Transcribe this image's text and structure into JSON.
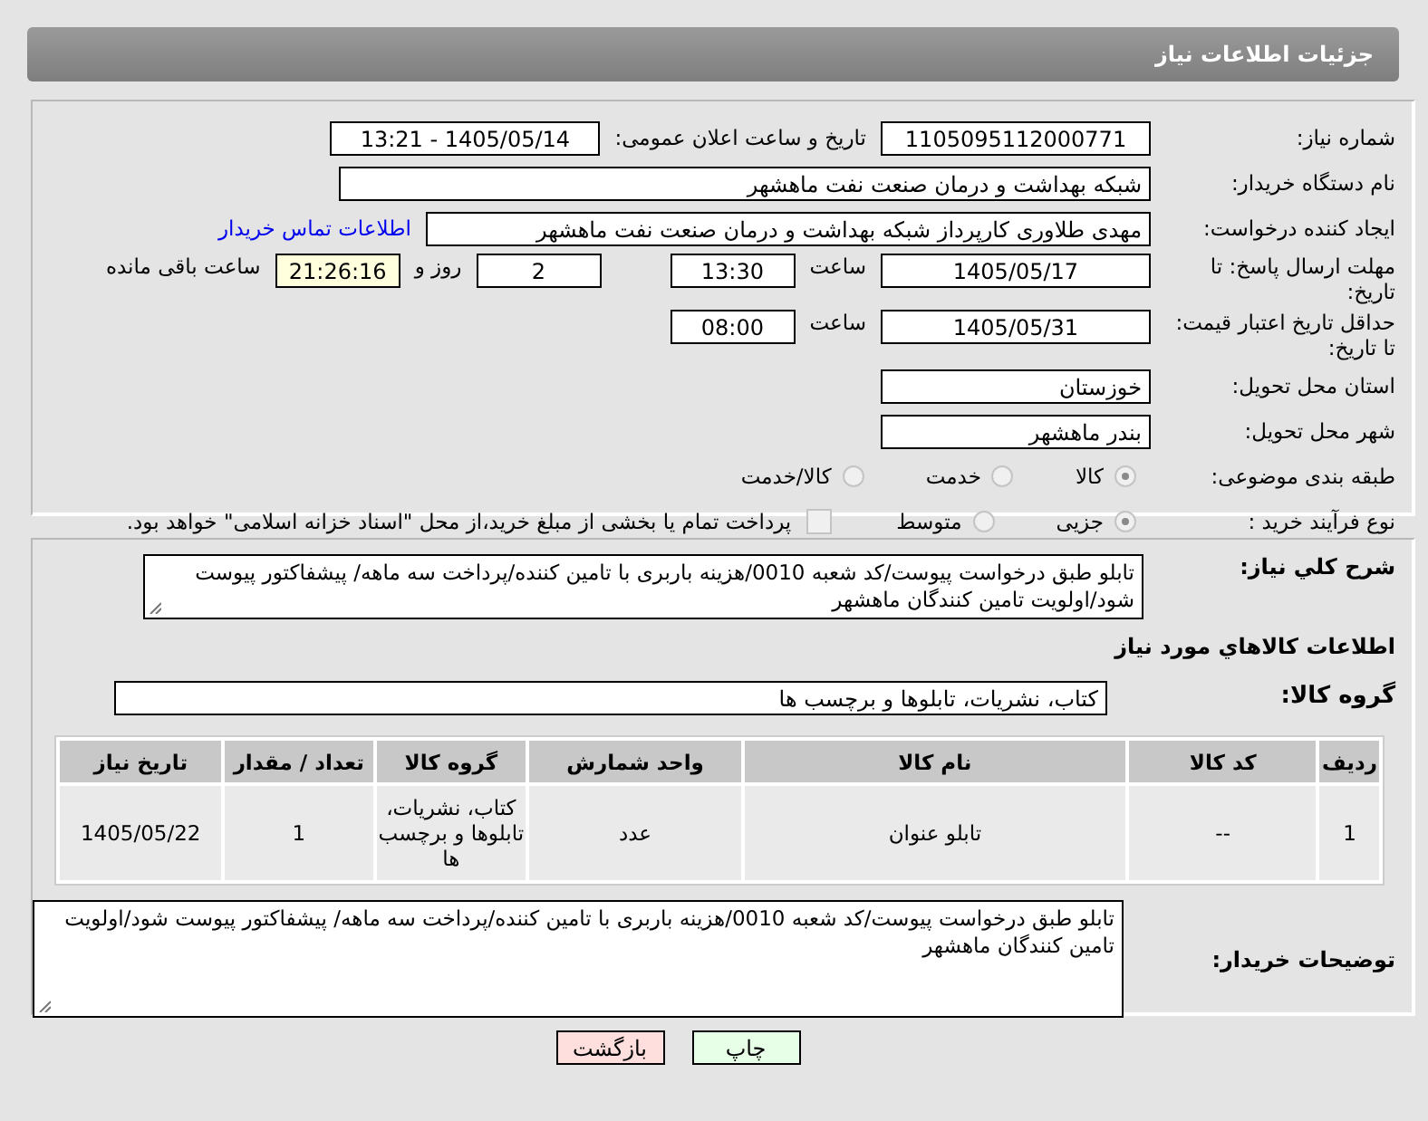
{
  "header": {
    "title": "جزئیات اطلاعات نیاز"
  },
  "need_number": {
    "label": "شماره نیاز:",
    "value": "1105095112000771"
  },
  "announce": {
    "label": "تاریخ و ساعت اعلان عمومی:",
    "value": "1405/05/14 - 13:21"
  },
  "buyer_org": {
    "label": "نام دستگاه خریدار:",
    "value": "شبکه بهداشت و درمان صنعت نفت ماهشهر"
  },
  "requester": {
    "label": "ایجاد کننده درخواست:",
    "value": "مهدی طلاوری کارپرداز شبکه بهداشت و درمان صنعت نفت ماهشهر",
    "link": "اطلاعات تماس خریدار"
  },
  "reply_deadline": {
    "label": "مهلت ارسال پاسخ: تا تاریخ:",
    "date": "1405/05/17",
    "time_label": "ساعت",
    "time": "13:30",
    "days": "2",
    "days_label": "روز و",
    "remaining": "21:26:16",
    "remaining_label": "ساعت باقی مانده"
  },
  "price_validity": {
    "label": "حداقل تاریخ اعتبار قیمت: تا تاریخ:",
    "date": "1405/05/31",
    "time_label": "ساعت",
    "time": "08:00"
  },
  "province": {
    "label": "استان محل تحویل:",
    "value": "خوزستان"
  },
  "city": {
    "label": "شهر محل تحویل:",
    "value": "بندر ماهشهر"
  },
  "category": {
    "label": "طبقه بندی موضوعی:",
    "options": [
      {
        "label": "کالا",
        "selected": true
      },
      {
        "label": "خدمت",
        "selected": false
      },
      {
        "label": "کالا/خدمت",
        "selected": false
      }
    ]
  },
  "purchase_type": {
    "label": "نوع فرآیند خرید :",
    "options": [
      {
        "label": "جزیی",
        "selected": true
      },
      {
        "label": "متوسط",
        "selected": false
      }
    ],
    "payment_note": {
      "checked": false,
      "text": "پرداخت تمام یا بخشی از مبلغ خرید،از محل \"اسناد خزانه اسلامی\" خواهد بود."
    }
  },
  "description": {
    "label": "شرح کلي نياز:",
    "value": "تابلو طبق درخواست پیوست/کد شعبه 0010/هزینه باربری با تامین کننده/پرداخت سه ماهه/ پیشفاکتور پیوست شود/اولویت تامین کنندگان ماهشهر"
  },
  "goods_title": "اطلاعات کالاهاي مورد نياز",
  "goods_group": {
    "label": "گروه کالا:",
    "value": "کتاب، نشریات، تابلوها و برچسب ها"
  },
  "table": {
    "columns": [
      "ردیف",
      "کد کالا",
      "نام کالا",
      "واحد شمارش",
      "گروه کالا",
      "تعداد / مقدار",
      "تاریخ نیاز"
    ],
    "rows": [
      [
        "1",
        "--",
        "تابلو عنوان",
        "عدد",
        "کتاب، نشریات، تابلوها و برچسب ها",
        "1",
        "1405/05/22"
      ]
    ]
  },
  "buyer_notes": {
    "label": "توضیحات خریدار:",
    "value": "تابلو طبق درخواست پیوست/کد شعبه 0010/هزینه باربری با تامین کننده/پرداخت سه ماهه/ پیشفاکتور پیوست شود/اولویت تامین کنندگان ماهشهر"
  },
  "buttons": [
    {
      "label": "چاپ",
      "kind": "print"
    },
    {
      "label": "بازگشت",
      "kind": "back"
    }
  ]
}
